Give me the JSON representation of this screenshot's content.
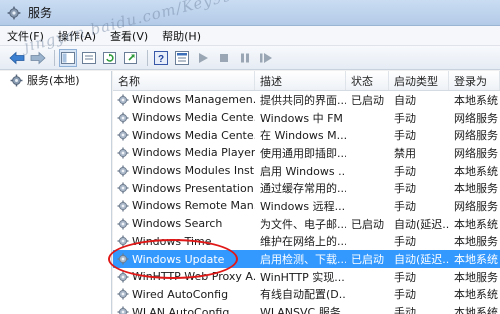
{
  "window": {
    "title": "服务"
  },
  "menu": [
    "文件(F)",
    "操作(A)",
    "查看(V)",
    "帮助(H)"
  ],
  "tree": {
    "root_label": "服务(本地)"
  },
  "columns": [
    "名称",
    "描述",
    "状态",
    "启动类型",
    "登录为"
  ],
  "rows": [
    {
      "name": "Windows Managemen...",
      "desc": "提供共同的界面...",
      "status": "已启动",
      "startup": "自动",
      "logon": "本地系统"
    },
    {
      "name": "Windows Media Cente...",
      "desc": "Windows 中 FM 广播...",
      "status": "",
      "startup": "手动",
      "logon": "网络服务"
    },
    {
      "name": "Windows Media Cente...",
      "desc": "在 Windows M...",
      "status": "",
      "startup": "手动",
      "logon": "网络服务"
    },
    {
      "name": "Windows Media Player...",
      "desc": "使用通用即插即...",
      "status": "",
      "startup": "禁用",
      "logon": "网络服务"
    },
    {
      "name": "Windows Modules Inst...",
      "desc": "启用 Windows ...",
      "status": "",
      "startup": "手动",
      "logon": "本地系统"
    },
    {
      "name": "Windows Presentation ...",
      "desc": "通过缓存常用的...",
      "status": "",
      "startup": "手动",
      "logon": "本地服务"
    },
    {
      "name": "Windows Remote Man...",
      "desc": "Windows 远程...",
      "status": "",
      "startup": "手动",
      "logon": "网络服务"
    },
    {
      "name": "Windows Search",
      "desc": "为文件、电子邮...",
      "status": "已启动",
      "startup": "自动(延迟...",
      "logon": "本地系统"
    },
    {
      "name": "Windows Time",
      "desc": "维护在网络上的...",
      "status": "",
      "startup": "手动",
      "logon": "本地服务"
    },
    {
      "name": "Windows Update",
      "desc": "启用检测、下载...",
      "status": "已启动",
      "startup": "自动(延迟...",
      "logon": "本地系统"
    },
    {
      "name": "WinHTTP Web Proxy A...",
      "desc": "WinHTTP 实现...",
      "status": "",
      "startup": "手动",
      "logon": "本地服务"
    },
    {
      "name": "Wired AutoConfig",
      "desc": "有线自动配置(D...",
      "status": "",
      "startup": "手动",
      "logon": "本地系统"
    },
    {
      "name": "WLAN AutoConfig",
      "desc": "WLANSVC 服务...",
      "status": "",
      "startup": "手动",
      "logon": "本地系统"
    }
  ],
  "selected_row_index": 9,
  "watermark": "jingyan.baidu.com/Key9928",
  "colors": {
    "selection": "#3399ff",
    "annotation": "#e01818",
    "titlebar": "#c9dcf2"
  },
  "icons": {
    "app": "services-gear-icon",
    "tree_root": "services-gear-icon",
    "row": "service-gear-icon"
  }
}
